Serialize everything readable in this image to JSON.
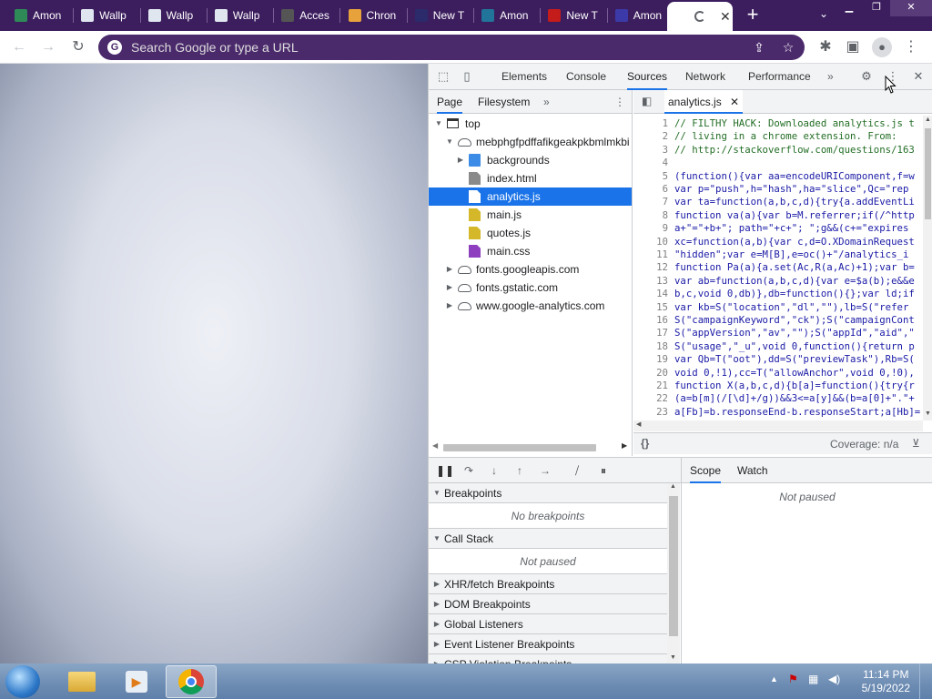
{
  "browser": {
    "tabs": [
      {
        "title": "Amon",
        "icon": "shield-icon",
        "color": "#2e8b57"
      },
      {
        "title": "Wallp",
        "icon": "doc-icon",
        "color": "#dfe6f0"
      },
      {
        "title": "Wallp",
        "icon": "doc-icon",
        "color": "#dfe6f0"
      },
      {
        "title": "Wallp",
        "icon": "doc-icon",
        "color": "#dfe6f0"
      },
      {
        "title": "Acces",
        "icon": "globe-icon",
        "color": "#555555"
      },
      {
        "title": "Chron",
        "icon": "rainbow-icon",
        "color": "#e8a23c"
      },
      {
        "title": "New T",
        "icon": "newtab-icon",
        "color": "#2b2b6b"
      },
      {
        "title": "Amon",
        "icon": "wordpress-icon",
        "color": "#21759b"
      },
      {
        "title": "New T",
        "icon": "amongus-icon",
        "color": "#c41b1b"
      },
      {
        "title": "Amon",
        "icon": "u-icon",
        "color": "#3c3aa8"
      }
    ],
    "omnibox_placeholder": "Search Google or type a URL",
    "theme_color": "#3c1e5e"
  },
  "devtools": {
    "tabs": [
      "Elements",
      "Console",
      "Sources",
      "Network",
      "Performance"
    ],
    "active_tab": "Sources",
    "more_tabs": "»",
    "navigator_tabs": [
      "Page",
      "Filesystem"
    ],
    "tree": [
      {
        "label": "top",
        "indent": 0,
        "arrow": "▼",
        "icon": "frame"
      },
      {
        "label": "mebphgfpdffafikgeakpkbmlmkbi",
        "indent": 1,
        "arrow": "▼",
        "icon": "cloud"
      },
      {
        "label": "backgrounds",
        "indent": 2,
        "arrow": "▶",
        "icon": "folder"
      },
      {
        "label": "index.html",
        "indent": 2,
        "arrow": "",
        "icon": "file-gray"
      },
      {
        "label": "analytics.js",
        "indent": 2,
        "arrow": "",
        "icon": "file-white",
        "selected": true
      },
      {
        "label": "main.js",
        "indent": 2,
        "arrow": "",
        "icon": "file-js"
      },
      {
        "label": "quotes.js",
        "indent": 2,
        "arrow": "",
        "icon": "file-js"
      },
      {
        "label": "main.css",
        "indent": 2,
        "arrow": "",
        "icon": "file-css"
      },
      {
        "label": "fonts.googleapis.com",
        "indent": 1,
        "arrow": "▶",
        "icon": "cloud"
      },
      {
        "label": "fonts.gstatic.com",
        "indent": 1,
        "arrow": "▶",
        "icon": "cloud"
      },
      {
        "label": "www.google-analytics.com",
        "indent": 1,
        "arrow": "▶",
        "icon": "cloud"
      }
    ],
    "editor_tab": "analytics.js",
    "code_lines": [
      {
        "n": "1",
        "t": "// FILTHY HACK: Downloaded analytics.js t",
        "c": true
      },
      {
        "n": "2",
        "t": "// living in a chrome extension. From:",
        "c": true
      },
      {
        "n": "3",
        "t": "// http://stackoverflow.com/questions/163",
        "c": true
      },
      {
        "n": "4",
        "t": "",
        "c": false
      },
      {
        "n": "5",
        "t": "(function(){var aa=encodeURIComponent,f=w",
        "c": false
      },
      {
        "n": "6",
        "t": "var p=\"push\",h=\"hash\",ha=\"slice\",Qc=\"rep",
        "c": false
      },
      {
        "n": "7",
        "t": "var ta=function(a,b,c,d){try{a.addEventLi",
        "c": false
      },
      {
        "n": "8",
        "t": "function va(a){var b=M.referrer;if(/^http",
        "c": false
      },
      {
        "n": "9",
        "t": "a+\"=\"+b+\"; path=\"+c+\"; \";g&&(c+=\"expires",
        "c": false
      },
      {
        "n": "10",
        "t": "xc=function(a,b){var c,d=O.XDomainRequest",
        "c": false
      },
      {
        "n": "11",
        "t": "\"hidden\";var e=M[B],e=oc()+\"/analytics_i",
        "c": false
      },
      {
        "n": "12",
        "t": "function Pa(a){a.set(Ac,R(a,Ac)+1);var b=",
        "c": false
      },
      {
        "n": "13",
        "t": "var ab=function(a,b,c,d){var e=$a(b);e&&e",
        "c": false
      },
      {
        "n": "14",
        "t": "b,c,void 0,db)},db=function(){};var ld;if",
        "c": false
      },
      {
        "n": "15",
        "t": "var kb=S(\"location\",\"dl\",\"\"),lb=S(\"refer",
        "c": false
      },
      {
        "n": "16",
        "t": "S(\"campaignKeyword\",\"ck\");S(\"campaignCont",
        "c": false
      },
      {
        "n": "17",
        "t": "S(\"appVersion\",\"av\",\"\");S(\"appId\",\"aid\",\"",
        "c": false
      },
      {
        "n": "18",
        "t": "S(\"usage\",\"_u\",void 0,function(){return p",
        "c": false
      },
      {
        "n": "19",
        "t": "var Qb=T(\"oot\"),dd=S(\"previewTask\"),Rb=S(",
        "c": false
      },
      {
        "n": "20",
        "t": "void 0,!1),cc=T(\"allowAnchor\",void 0,!0),",
        "c": false
      },
      {
        "n": "21",
        "t": "function X(a,b,c,d){b[a]=function(){try{r",
        "c": false
      },
      {
        "n": "22",
        "t": "(a=b[m](/[\\d]+/g))&&3<=a[y]&&(b=a[0]+\".\"+",
        "c": false
      },
      {
        "n": "23",
        "t": "a[Fb]=b.responseEnd-b.responseStart;a[Hb]=",
        "c": false
      }
    ],
    "pretty_print": "{}",
    "coverage": "Coverage: n/a",
    "breakpoints_title": "Breakpoints",
    "no_breakpoints": "No breakpoints",
    "call_stack_title": "Call Stack",
    "not_paused": "Not paused",
    "sections": [
      "XHR/fetch Breakpoints",
      "DOM Breakpoints",
      "Global Listeners",
      "Event Listener Breakpoints",
      "CSP Violation Breakpoints"
    ],
    "scope_tabs": [
      "Scope",
      "Watch"
    ],
    "scope_not_paused": "Not paused"
  },
  "taskbar": {
    "time": "11:14 PM",
    "date": "5/19/2022"
  }
}
